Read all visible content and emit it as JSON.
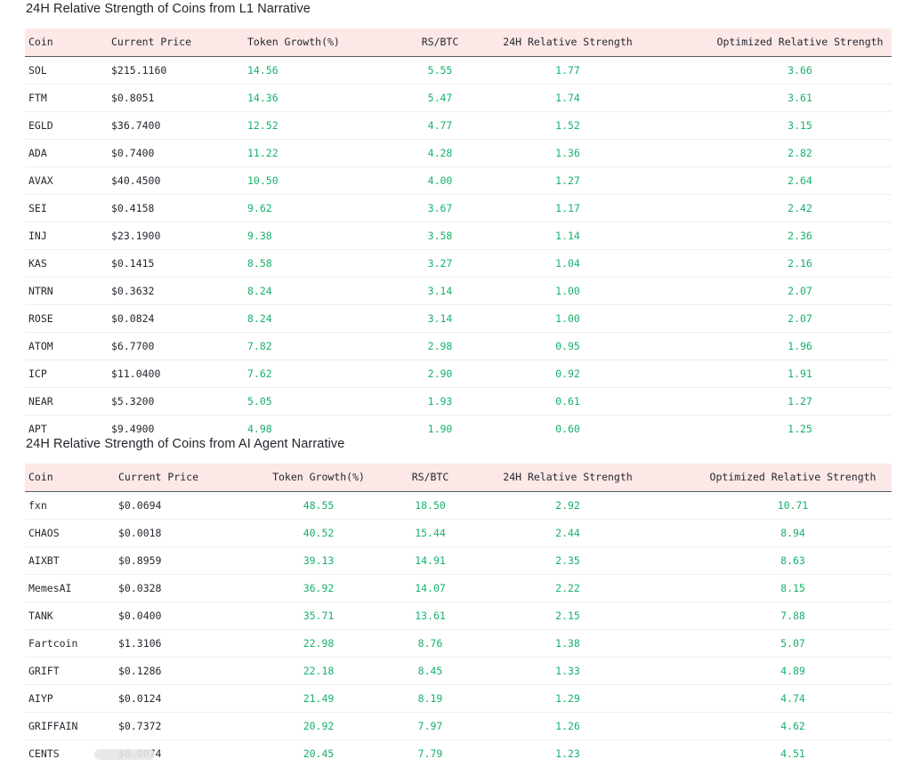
{
  "sections": [
    {
      "title": "24H Relative Strength of Coins from L1 Narrative",
      "headers": [
        "Coin",
        "Current Price",
        "Token Growth(%)",
        "RS/BTC",
        "24H Relative Strength",
        "Optimized Relative Strength"
      ],
      "rows": [
        [
          "SOL",
          "$215.1160",
          "14.56",
          "5.55",
          "1.77",
          "3.66"
        ],
        [
          "FTM",
          "$0.8051",
          "14.36",
          "5.47",
          "1.74",
          "3.61"
        ],
        [
          "EGLD",
          "$36.7400",
          "12.52",
          "4.77",
          "1.52",
          "3.15"
        ],
        [
          "ADA",
          "$0.7400",
          "11.22",
          "4.28",
          "1.36",
          "2.82"
        ],
        [
          "AVAX",
          "$40.4500",
          "10.50",
          "4.00",
          "1.27",
          "2.64"
        ],
        [
          "SEI",
          "$0.4158",
          "9.62",
          "3.67",
          "1.17",
          "2.42"
        ],
        [
          "INJ",
          "$23.1900",
          "9.38",
          "3.58",
          "1.14",
          "2.36"
        ],
        [
          "KAS",
          "$0.1415",
          "8.58",
          "3.27",
          "1.04",
          "2.16"
        ],
        [
          "NTRN",
          "$0.3632",
          "8.24",
          "3.14",
          "1.00",
          "2.07"
        ],
        [
          "ROSE",
          "$0.0824",
          "8.24",
          "3.14",
          "1.00",
          "2.07"
        ],
        [
          "ATOM",
          "$6.7700",
          "7.82",
          "2.98",
          "0.95",
          "1.96"
        ],
        [
          "ICP",
          "$11.0400",
          "7.62",
          "2.90",
          "0.92",
          "1.91"
        ],
        [
          "NEAR",
          "$5.3200",
          "5.05",
          "1.93",
          "0.61",
          "1.27"
        ],
        [
          "APT",
          "$9.4900",
          "4.98",
          "1.90",
          "0.60",
          "1.25"
        ]
      ]
    },
    {
      "title": "24H Relative Strength of Coins from AI Agent Narrative",
      "headers": [
        "Coin",
        "Current Price",
        "Token Growth(%)",
        "RS/BTC",
        "24H Relative Strength",
        "Optimized Relative Strength"
      ],
      "rows": [
        [
          "fxn",
          "$0.0694",
          "48.55",
          "18.50",
          "2.92",
          "10.71"
        ],
        [
          "CHAOS",
          "$0.0018",
          "40.52",
          "15.44",
          "2.44",
          "8.94"
        ],
        [
          "AIXBT",
          "$0.8959",
          "39.13",
          "14.91",
          "2.35",
          "8.63"
        ],
        [
          "MemesAI",
          "$0.0328",
          "36.92",
          "14.07",
          "2.22",
          "8.15"
        ],
        [
          "TANK",
          "$0.0400",
          "35.71",
          "13.61",
          "2.15",
          "7.88"
        ],
        [
          "Fartcoin",
          "$1.3106",
          "22.98",
          "8.76",
          "1.38",
          "5.07"
        ],
        [
          "GRIFT",
          "$0.1286",
          "22.18",
          "8.45",
          "1.33",
          "4.89"
        ],
        [
          "AIYP",
          "$0.0124",
          "21.49",
          "8.19",
          "1.29",
          "4.74"
        ],
        [
          "GRIFFAIN",
          "$0.7372",
          "20.92",
          "7.97",
          "1.26",
          "4.62"
        ],
        [
          "CENTS",
          "$0.0074",
          "20.45",
          "7.79",
          "1.23",
          "4.51"
        ]
      ]
    }
  ],
  "colors": {
    "header_bg": "#fde8e8",
    "numeric_text": "#17b16a",
    "text": "#24292f"
  }
}
